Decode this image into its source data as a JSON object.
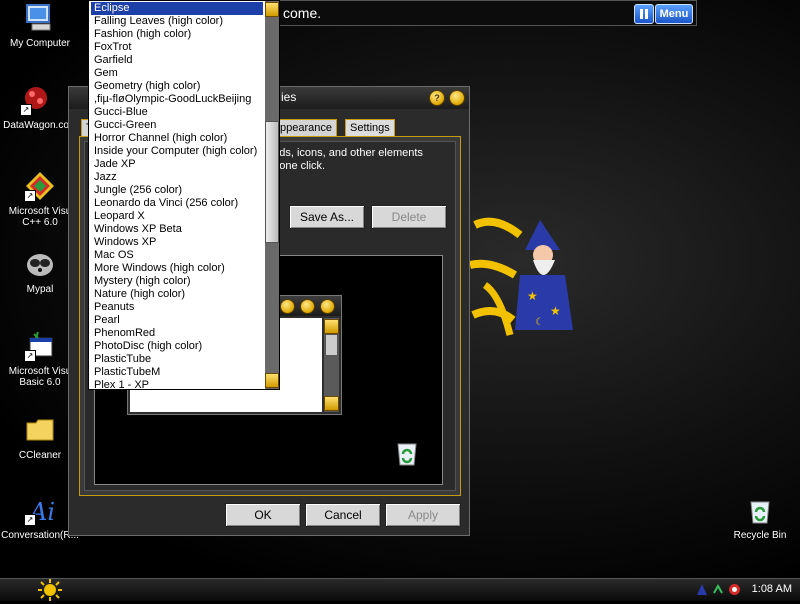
{
  "desktop_icons": [
    {
      "label": "My Computer",
      "icon": "computer-icon"
    },
    {
      "label": "DataWagon.co",
      "icon": "datawagon-icon"
    },
    {
      "label": "Microsoft Visu C++ 6.0",
      "icon": "visual-cpp-icon"
    },
    {
      "label": "Mypal",
      "icon": "mypal-browser-icon"
    },
    {
      "label": "Microsoft Visu Basic 6.0",
      "icon": "visual-basic-icon"
    },
    {
      "label": "CCleaner",
      "icon": "ccleaner-folder-icon"
    },
    {
      "label": "Conversation(R...",
      "icon": "agent-icon"
    },
    {
      "label": "Recycle Bin",
      "icon": "recycle-bin-icon"
    }
  ],
  "top_window": {
    "title_fragment": "come.",
    "menu_label": "Menu"
  },
  "dialog": {
    "title_fragment": "ies",
    "tabs": [
      {
        "label": "T"
      },
      {
        "label": "ppearance"
      },
      {
        "label": "Settings"
      }
    ],
    "description": "unds, icons, and other elements\nth one click.",
    "save_as_label": "Save As...",
    "delete_label": "Delete",
    "ok_label": "OK",
    "cancel_label": "Cancel",
    "apply_label": "Apply"
  },
  "theme_list": {
    "selected": "Eclipse",
    "items": [
      "Eclipse",
      "Falling Leaves (high color)",
      "Fashion (high color)",
      "FoxTrot",
      "Garfield",
      "Gem",
      "Geometry (high color)",
      ",ﬁµ-ﬂøOlympic-GoodLuckBeijing",
      "Gucci-Blue",
      "Gucci-Green",
      "Horror Channel (high color)",
      "Inside your Computer (high color)",
      "Jade XP",
      "Jazz",
      "Jungle (256 color)",
      "Leonardo da Vinci (256 color)",
      "Leopard X",
      "Windows XP Beta",
      "Windows XP",
      "Mac OS",
      "More Windows (high color)",
      "Mystery (high color)",
      "Nature (high color)",
      "Peanuts",
      "Pearl",
      "PhenomRed",
      "PhotoDisc (high color)",
      "PlasticTube",
      "PlasticTubeM",
      "Plex 1 - XP"
    ]
  },
  "taskbar": {
    "clock": "1:08 AM"
  },
  "colors": {
    "selection": "#1d3fa8",
    "accent_gold": "#e0a800",
    "menu_blue": "#1a56c8"
  }
}
